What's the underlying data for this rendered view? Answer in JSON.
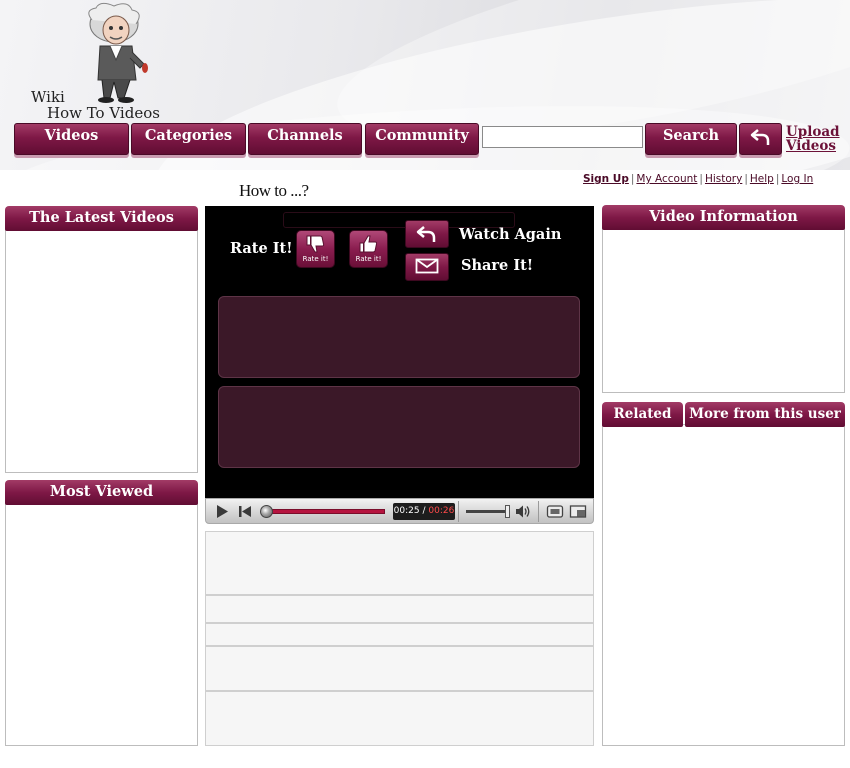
{
  "brand": {
    "line1": "Wiki",
    "line2": "How To Videos"
  },
  "nav": {
    "videos": "Videos",
    "categories": "Categories",
    "channels": "Channels",
    "community": "Community"
  },
  "search": {
    "value": "",
    "button": "Search"
  },
  "upload": {
    "line1": "Upload",
    "line2": "Videos"
  },
  "user_links": {
    "signup": "Sign Up",
    "account": "My Account",
    "history": "History",
    "help": "Help",
    "login": "Log In",
    "separator": "|"
  },
  "page_title": "How to ...?",
  "left": {
    "latest": "The Latest Videos",
    "most_viewed": "Most Viewed"
  },
  "right": {
    "video_info": "Video Information",
    "related": "Related",
    "more_from_user": "More from this user"
  },
  "player": {
    "rate_label": "Rate It!",
    "rate_button_text": "Rate it!",
    "watch_again": "Watch Again",
    "share": "Share It!",
    "time_current": "00:25",
    "time_sep": " / ",
    "time_total": "00:26",
    "progress_fraction": 1.0,
    "volume_fraction": 0.9
  },
  "colors": {
    "brand_maroon": "#7e1846",
    "player_bg": "#000000",
    "player_box": "#3b1828",
    "seek_bar": "#b6143f"
  },
  "icons": {
    "thumb_down": "thumbs-down-icon",
    "thumb_up": "thumbs-up-icon",
    "back": "back-arrow-icon",
    "share": "envelope-icon",
    "play": "play-icon",
    "prev": "skip-back-icon",
    "volume": "volume-icon"
  }
}
